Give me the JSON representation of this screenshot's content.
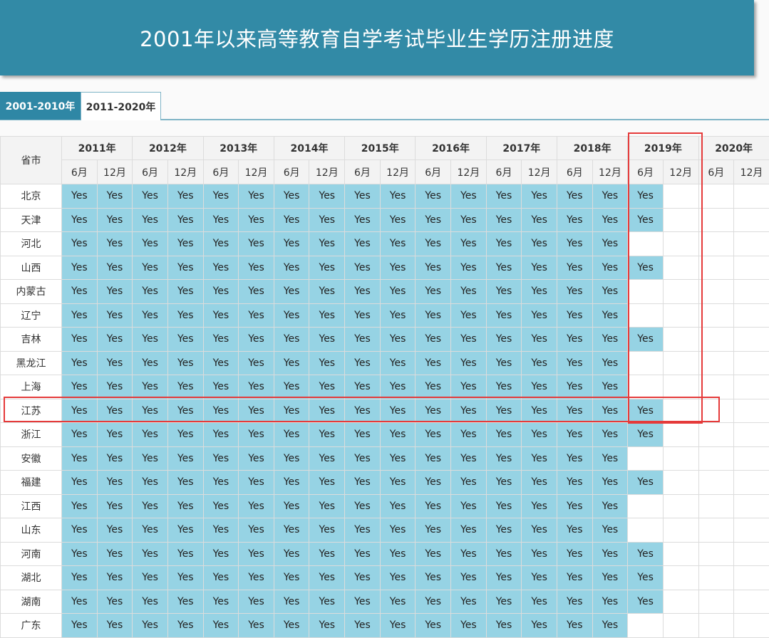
{
  "header": {
    "title": "2001年以来高等教育自学考试毕业生学历注册进度"
  },
  "tabs": [
    {
      "label": "2001-2010年",
      "active": true
    },
    {
      "label": "2011-2020年",
      "active": false
    }
  ],
  "table": {
    "province_header": "省市",
    "years": [
      "2011年",
      "2012年",
      "2013年",
      "2014年",
      "2015年",
      "2016年",
      "2017年",
      "2018年",
      "2019年",
      "2020年"
    ],
    "months": [
      "6月",
      "12月"
    ],
    "rows": [
      {
        "province": "北京",
        "values": [
          "Yes",
          "Yes",
          "Yes",
          "Yes",
          "Yes",
          "Yes",
          "Yes",
          "Yes",
          "Yes",
          "Yes",
          "Yes",
          "Yes",
          "Yes",
          "Yes",
          "Yes",
          "Yes",
          "Yes",
          "",
          "",
          ""
        ]
      },
      {
        "province": "天津",
        "values": [
          "Yes",
          "Yes",
          "Yes",
          "Yes",
          "Yes",
          "Yes",
          "Yes",
          "Yes",
          "Yes",
          "Yes",
          "Yes",
          "Yes",
          "Yes",
          "Yes",
          "Yes",
          "Yes",
          "Yes",
          "",
          "",
          ""
        ]
      },
      {
        "province": "河北",
        "values": [
          "Yes",
          "Yes",
          "Yes",
          "Yes",
          "Yes",
          "Yes",
          "Yes",
          "Yes",
          "Yes",
          "Yes",
          "Yes",
          "Yes",
          "Yes",
          "Yes",
          "Yes",
          "Yes",
          "",
          "",
          "",
          ""
        ]
      },
      {
        "province": "山西",
        "values": [
          "Yes",
          "Yes",
          "Yes",
          "Yes",
          "Yes",
          "Yes",
          "Yes",
          "Yes",
          "Yes",
          "Yes",
          "Yes",
          "Yes",
          "Yes",
          "Yes",
          "Yes",
          "Yes",
          "Yes",
          "",
          "",
          ""
        ]
      },
      {
        "province": "内蒙古",
        "values": [
          "Yes",
          "Yes",
          "Yes",
          "Yes",
          "Yes",
          "Yes",
          "Yes",
          "Yes",
          "Yes",
          "Yes",
          "Yes",
          "Yes",
          "Yes",
          "Yes",
          "Yes",
          "Yes",
          "",
          "",
          "",
          ""
        ]
      },
      {
        "province": "辽宁",
        "values": [
          "Yes",
          "Yes",
          "Yes",
          "Yes",
          "Yes",
          "Yes",
          "Yes",
          "Yes",
          "Yes",
          "Yes",
          "Yes",
          "Yes",
          "Yes",
          "Yes",
          "Yes",
          "Yes",
          "",
          "",
          "",
          ""
        ]
      },
      {
        "province": "吉林",
        "values": [
          "Yes",
          "Yes",
          "Yes",
          "Yes",
          "Yes",
          "Yes",
          "Yes",
          "Yes",
          "Yes",
          "Yes",
          "Yes",
          "Yes",
          "Yes",
          "Yes",
          "Yes",
          "Yes",
          "Yes",
          "",
          "",
          ""
        ]
      },
      {
        "province": "黑龙江",
        "values": [
          "Yes",
          "Yes",
          "Yes",
          "Yes",
          "Yes",
          "Yes",
          "Yes",
          "Yes",
          "Yes",
          "Yes",
          "Yes",
          "Yes",
          "Yes",
          "Yes",
          "Yes",
          "Yes",
          "",
          "",
          "",
          ""
        ]
      },
      {
        "province": "上海",
        "values": [
          "Yes",
          "Yes",
          "Yes",
          "Yes",
          "Yes",
          "Yes",
          "Yes",
          "Yes",
          "Yes",
          "Yes",
          "Yes",
          "Yes",
          "Yes",
          "Yes",
          "Yes",
          "Yes",
          "",
          "",
          "",
          ""
        ]
      },
      {
        "province": "江苏",
        "values": [
          "Yes",
          "Yes",
          "Yes",
          "Yes",
          "Yes",
          "Yes",
          "Yes",
          "Yes",
          "Yes",
          "Yes",
          "Yes",
          "Yes",
          "Yes",
          "Yes",
          "Yes",
          "Yes",
          "Yes",
          "",
          "",
          ""
        ]
      },
      {
        "province": "浙江",
        "values": [
          "Yes",
          "Yes",
          "Yes",
          "Yes",
          "Yes",
          "Yes",
          "Yes",
          "Yes",
          "Yes",
          "Yes",
          "Yes",
          "Yes",
          "Yes",
          "Yes",
          "Yes",
          "Yes",
          "Yes",
          "",
          "",
          ""
        ]
      },
      {
        "province": "安徽",
        "values": [
          "Yes",
          "Yes",
          "Yes",
          "Yes",
          "Yes",
          "Yes",
          "Yes",
          "Yes",
          "Yes",
          "Yes",
          "Yes",
          "Yes",
          "Yes",
          "Yes",
          "Yes",
          "Yes",
          "",
          "",
          "",
          ""
        ]
      },
      {
        "province": "福建",
        "values": [
          "Yes",
          "Yes",
          "Yes",
          "Yes",
          "Yes",
          "Yes",
          "Yes",
          "Yes",
          "Yes",
          "Yes",
          "Yes",
          "Yes",
          "Yes",
          "Yes",
          "Yes",
          "Yes",
          "Yes",
          "",
          "",
          ""
        ]
      },
      {
        "province": "江西",
        "values": [
          "Yes",
          "Yes",
          "Yes",
          "Yes",
          "Yes",
          "Yes",
          "Yes",
          "Yes",
          "Yes",
          "Yes",
          "Yes",
          "Yes",
          "Yes",
          "Yes",
          "Yes",
          "Yes",
          "",
          "",
          "",
          ""
        ]
      },
      {
        "province": "山东",
        "values": [
          "Yes",
          "Yes",
          "Yes",
          "Yes",
          "Yes",
          "Yes",
          "Yes",
          "Yes",
          "Yes",
          "Yes",
          "Yes",
          "Yes",
          "Yes",
          "Yes",
          "Yes",
          "Yes",
          "",
          "",
          "",
          ""
        ]
      },
      {
        "province": "河南",
        "values": [
          "Yes",
          "Yes",
          "Yes",
          "Yes",
          "Yes",
          "Yes",
          "Yes",
          "Yes",
          "Yes",
          "Yes",
          "Yes",
          "Yes",
          "Yes",
          "Yes",
          "Yes",
          "Yes",
          "Yes",
          "",
          "",
          ""
        ]
      },
      {
        "province": "湖北",
        "values": [
          "Yes",
          "Yes",
          "Yes",
          "Yes",
          "Yes",
          "Yes",
          "Yes",
          "Yes",
          "Yes",
          "Yes",
          "Yes",
          "Yes",
          "Yes",
          "Yes",
          "Yes",
          "Yes",
          "Yes",
          "",
          "",
          ""
        ]
      },
      {
        "province": "湖南",
        "values": [
          "Yes",
          "Yes",
          "Yes",
          "Yes",
          "Yes",
          "Yes",
          "Yes",
          "Yes",
          "Yes",
          "Yes",
          "Yes",
          "Yes",
          "Yes",
          "Yes",
          "Yes",
          "Yes",
          "Yes",
          "",
          "",
          ""
        ]
      },
      {
        "province": "广东",
        "values": [
          "Yes",
          "Yes",
          "Yes",
          "Yes",
          "Yes",
          "Yes",
          "Yes",
          "Yes",
          "Yes",
          "Yes",
          "Yes",
          "Yes",
          "Yes",
          "Yes",
          "Yes",
          "Yes",
          "",
          "",
          "",
          ""
        ]
      }
    ]
  },
  "highlights": {
    "column_year": "2019年",
    "row_province": "江苏",
    "color": "#e53a3a"
  },
  "colors": {
    "banner": "#328aa6",
    "tab_active": "#2f87a5",
    "cell_yes": "#96d3e4"
  }
}
